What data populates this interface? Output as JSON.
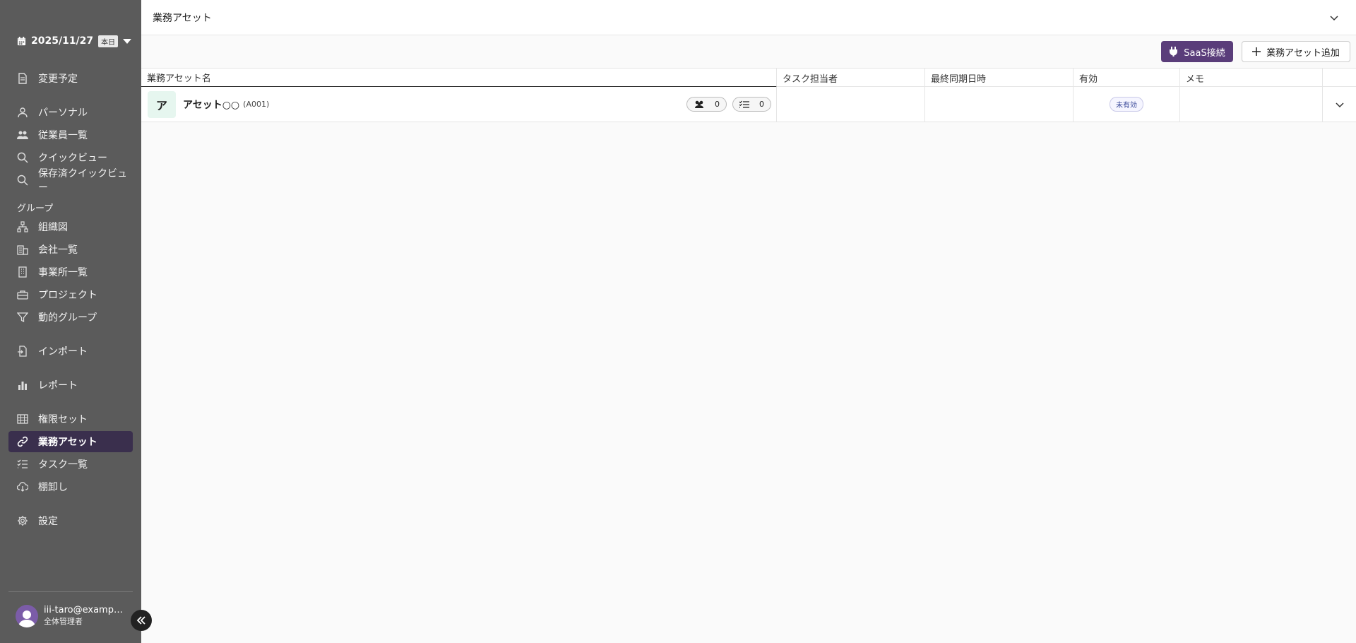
{
  "sidebar": {
    "date": "2025/11/27",
    "today_badge": "本日",
    "groups": [
      {
        "items": [
          {
            "label": "変更予定",
            "icon": "document-icon"
          }
        ]
      },
      {
        "items": [
          {
            "label": "パーソナル",
            "icon": "person-icon"
          },
          {
            "label": "従業員一覧",
            "icon": "people-icon"
          },
          {
            "label": "クイックビュー",
            "icon": "search-icon"
          },
          {
            "label": "保存済クイックビュー",
            "icon": "search-icon"
          }
        ]
      },
      {
        "heading": "グループ",
        "items": [
          {
            "label": "組織図",
            "icon": "org-chart-icon"
          },
          {
            "label": "会社一覧",
            "icon": "company-icon"
          },
          {
            "label": "事業所一覧",
            "icon": "building-icon"
          },
          {
            "label": "プロジェクト",
            "icon": "briefcase-icon"
          },
          {
            "label": "動的グループ",
            "icon": "filter-icon"
          }
        ]
      },
      {
        "items": [
          {
            "label": "インポート",
            "icon": "import-icon"
          }
        ]
      },
      {
        "items": [
          {
            "label": "レポート",
            "icon": "bar-chart-icon"
          }
        ]
      },
      {
        "items": [
          {
            "label": "権限セット",
            "icon": "grid-icon"
          },
          {
            "label": "業務アセット",
            "icon": "link-icon",
            "active": true
          },
          {
            "label": "タスク一覧",
            "icon": "checklist-icon"
          },
          {
            "label": "棚卸し",
            "icon": "cloud-download-icon"
          }
        ]
      },
      {
        "items": [
          {
            "label": "設定",
            "icon": "gear-icon"
          }
        ]
      }
    ],
    "user": {
      "email": "iii-taro@example.com",
      "role": "全体管理者"
    }
  },
  "header": {
    "title": "業務アセット"
  },
  "toolbar": {
    "saas_label": "SaaS接続",
    "add_label": "業務アセット追加",
    "accent": "#5a3d7a"
  },
  "table": {
    "columns": [
      "業務アセット名",
      "タスク担当者",
      "最終同期日時",
      "有効",
      "メモ"
    ],
    "rows": [
      {
        "icon_char": "ア",
        "name": "アセット○○",
        "code": "(A001)",
        "member_count": "0",
        "task_count": "0",
        "assignee": "",
        "last_sync": "",
        "status": "未有効",
        "memo": ""
      }
    ]
  }
}
